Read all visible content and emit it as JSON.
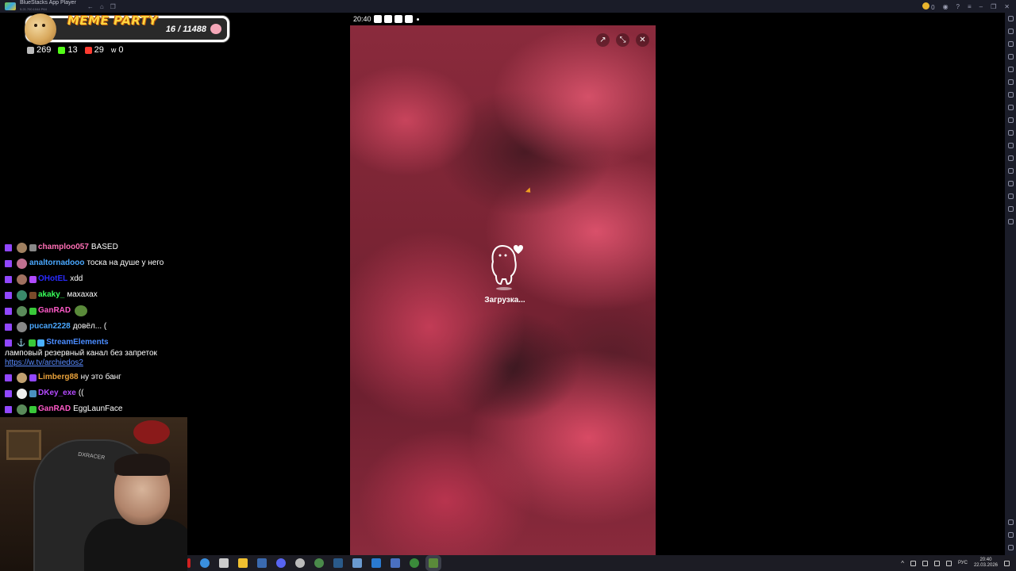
{
  "window": {
    "title": "BlueStacks App Player",
    "subtitle": "5.21.700.1044 P64",
    "coins": "0"
  },
  "meme_party": {
    "title": "MEME PARTY",
    "count": "16 / 11488"
  },
  "stats": [
    {
      "icon": "viewers-icon",
      "value": "269",
      "color": "#ffffff"
    },
    {
      "icon": "kick-icon",
      "value": "13",
      "color": "#53fc18"
    },
    {
      "icon": "vk-live-icon",
      "value": "29",
      "color": "#ff3b30"
    },
    {
      "icon": "w-icon",
      "value": "0",
      "color": "#ffffff"
    }
  ],
  "chat": [
    {
      "user": "champloo057",
      "color": "#ff6fb5",
      "text": "BASED"
    },
    {
      "user": "analtornadooo",
      "color": "#4aa8ff",
      "text": "тоска на душе у него"
    },
    {
      "user": "OHotEL",
      "color": "#2a2aff",
      "text": "xdd"
    },
    {
      "user": "akaky_",
      "color": "#39ff5a",
      "text": "махахах"
    },
    {
      "user": "GanRAD",
      "color": "#ff5ac8",
      "text": ""
    },
    {
      "user": "pucan2228",
      "color": "#4aa8ff",
      "text": "довёл... ("
    },
    {
      "user": "StreamElements",
      "color": "#4a8cff",
      "text": "ламповый резервный канал без запреток",
      "link": "https://w.tv/archiedos2"
    },
    {
      "user": "Limberg88",
      "color": "#e8a13a",
      "text": "ну это банг"
    },
    {
      "user": "DKey_exe",
      "color": "#b54aff",
      "text": "(("
    },
    {
      "user": "GanRAD",
      "color": "#ff5ac8",
      "text": "EggLaunFace"
    }
  ],
  "webcam": {
    "chair_text": "DXRACER"
  },
  "phone": {
    "time": "20:40",
    "loading": "Загрузка..."
  },
  "taskbar": {
    "lang": "РУС",
    "time": "20:40",
    "date": "22.03.2026"
  }
}
